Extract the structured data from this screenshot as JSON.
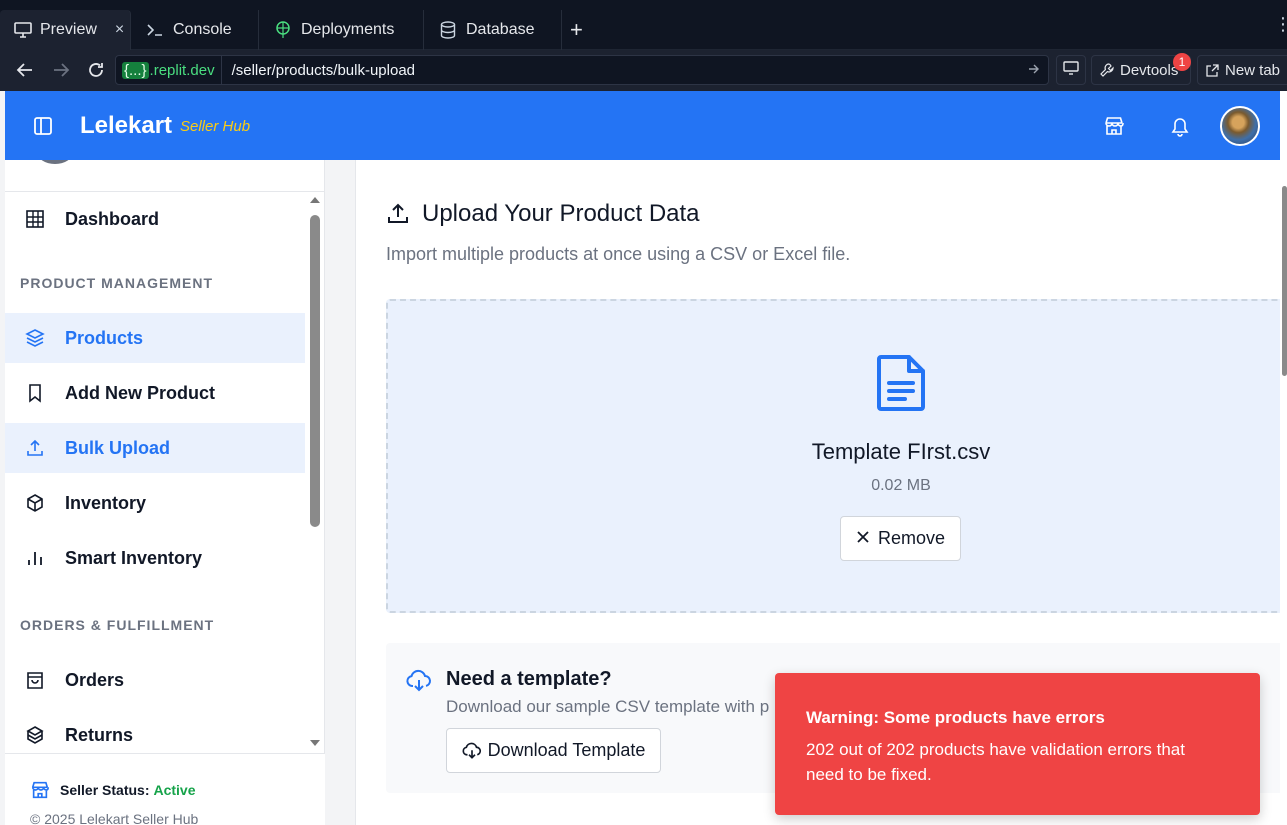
{
  "browser": {
    "tabs": [
      {
        "label": "Preview",
        "icon": "monitor-icon",
        "active": true
      },
      {
        "label": "Console",
        "icon": "terminal-icon"
      },
      {
        "label": "Deployments",
        "icon": "deploy-icon"
      },
      {
        "label": "Database",
        "icon": "database-icon"
      }
    ],
    "tab_close": "×",
    "new_tab": "+",
    "more": "⋮",
    "domain_braces": "{...}",
    "domain": ".replit.dev",
    "path": "/seller/products/bulk-upload",
    "devtools_label": "Devtools",
    "devtools_badge": "1",
    "newtab_label": "New tab"
  },
  "header": {
    "brand": "Lelekart",
    "brand_sub": "Seller Hub"
  },
  "sidebar": {
    "dashboard": "Dashboard",
    "section_product": "PRODUCT MANAGEMENT",
    "products": "Products",
    "add_new_product": "Add New Product",
    "bulk_upload": "Bulk Upload",
    "inventory": "Inventory",
    "smart_inventory": "Smart Inventory",
    "section_orders": "ORDERS & FULFILLMENT",
    "orders": "Orders",
    "returns": "Returns",
    "status_label": "Seller Status:",
    "status_value": "Active",
    "copyright": "© 2025 Lelekart Seller Hub"
  },
  "main": {
    "title": "Upload Your Product Data",
    "subtitle": "Import multiple products at once using a CSV or Excel file.",
    "file_name": "Template FIrst.csv",
    "file_size": "0.02 MB",
    "remove_label": "Remove",
    "template_title": "Need a template?",
    "template_desc": "Download our sample CSV template with p",
    "download_label": "Download Template"
  },
  "toast": {
    "title": "Warning: Some products have errors",
    "message": "202 out of 202 products have validation errors that need to be fixed."
  },
  "colors": {
    "primary": "#2474f4",
    "accent_yellow": "#facc15",
    "toast_red": "#ef4444",
    "status_green": "#16a34a"
  }
}
